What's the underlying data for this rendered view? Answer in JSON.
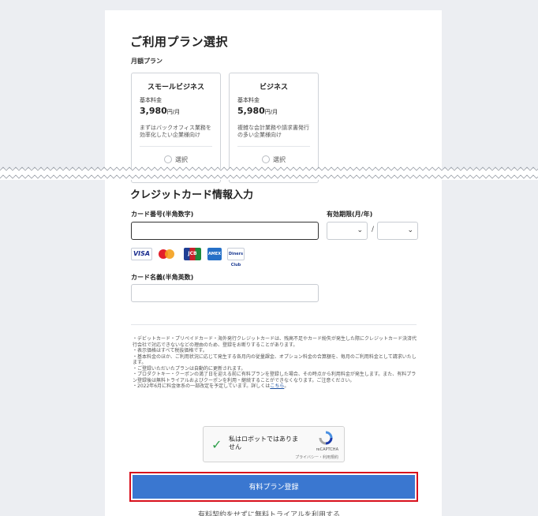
{
  "plan_section": {
    "title": "ご利用プラン選択",
    "subtitle": "月額プラン",
    "plans": [
      {
        "name": "スモールビジネス",
        "price_label": "基本料金",
        "price": "3,980",
        "price_unit": "円/月",
        "description": "まずはバックオフィス業務を効率化したい企業様向け",
        "select_label": "選択"
      },
      {
        "name": "ビジネス",
        "price_label": "基本料金",
        "price": "5,980",
        "price_unit": "円/月",
        "description": "複雑な会計業務や請求書発行の多い企業様向け",
        "select_label": "選択"
      }
    ]
  },
  "card_section": {
    "title": "クレジットカード情報入力",
    "card_number_label": "カード番号(半角数字)",
    "expiry_label": "有効期限(月/年)",
    "expiry_separator": "/",
    "card_name_label": "カード名義(半角英数)",
    "brands": {
      "visa": "VISA",
      "mastercard": "mastercard-icon",
      "jcb": "JCB",
      "amex": "AMEX",
      "diners": "Diners Club"
    }
  },
  "notes": {
    "items": [
      "・デビットカード・プリペイドカード・海外発行クレジットカードは、残高不足やカード紛失が発生した際にクレジットカード決済代行会社で対応できないなどの理由のため、登録をお断りすることがあります。",
      "・表示価格はすべて税抜価格です。",
      "・基本料金のほか、ご利用状況に応じて発生する各月内の従量課金、オプション料金の合算額を、毎月のご利用料金として請求いたします。",
      "・ご登録いただいたプランは自動的に更新されます。",
      "・プロダクトキー・クーポンの満了日を迎える前に有料プランを登録した場合、その時点から利用料金が発生します。また、有料プラン登録後は無料トライアルおよびクーポンを利用・継続することができなくなります。ご注意ください。"
    ],
    "last_item_prefix": "・2022年6月に料金体系の一部改定を予定しています。詳しくは",
    "last_item_link": "こちら",
    "last_item_suffix": "。"
  },
  "captcha": {
    "text": "私はロボットではありません",
    "brand": "reCAPTCHA",
    "privacy": "プライバシー・利用規約"
  },
  "actions": {
    "submit_label": "有料プラン登録",
    "trial_link": "有料契約をせずに無料トライアルを利用する"
  },
  "colors": {
    "submit_bg": "#3a77d0",
    "highlight_outline": "#d8101c",
    "page_bg": "#eceef2"
  }
}
